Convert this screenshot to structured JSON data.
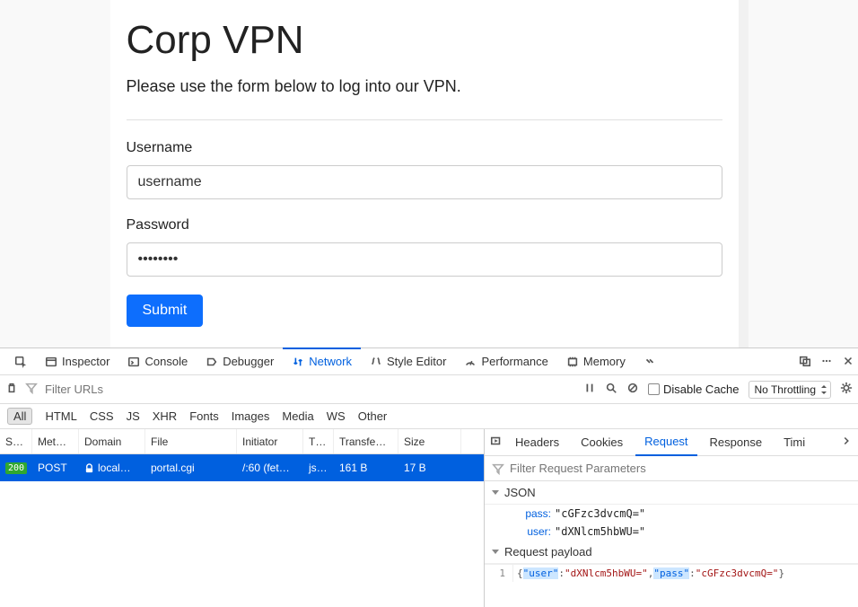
{
  "page": {
    "title": "Corp VPN",
    "subtitle": "Please use the form below to log into our VPN.",
    "username_label": "Username",
    "username_value": "username",
    "password_label": "Password",
    "password_value": "password",
    "submit_label": "Submit"
  },
  "devtools": {
    "tabs": {
      "inspector": "Inspector",
      "console": "Console",
      "debugger": "Debugger",
      "network": "Network",
      "style_editor": "Style Editor",
      "performance": "Performance",
      "memory": "Memory"
    },
    "active_tab": "network",
    "filter_placeholder": "Filter URLs",
    "disable_cache_label": "Disable Cache",
    "throttling_label": "No Throttling",
    "type_filters": [
      "All",
      "HTML",
      "CSS",
      "JS",
      "XHR",
      "Fonts",
      "Images",
      "Media",
      "WS",
      "Other"
    ],
    "type_active": "All",
    "columns": {
      "status": "S…",
      "method": "Met…",
      "domain": "Domain",
      "file": "File",
      "initiator": "Initiator",
      "type": "T…",
      "transferred": "Transfe…",
      "size": "Size"
    },
    "request_row": {
      "status": "200",
      "method": "POST",
      "domain": "local…",
      "file": "portal.cgi",
      "initiator": "/:60 (fet…",
      "type": "js…",
      "transferred": "161 B",
      "size": "17 B"
    },
    "details": {
      "tabs": {
        "headers": "Headers",
        "cookies": "Cookies",
        "request": "Request",
        "response": "Response",
        "timings": "Timi"
      },
      "active": "request",
      "filter_placeholder": "Filter Request Parameters",
      "json_heading": "JSON",
      "json_kv": {
        "pass_key": "pass:",
        "pass_val": "\"cGFzc3dvcmQ=\"",
        "user_key": "user:",
        "user_val": "\"dXNlcm5hbWU=\""
      },
      "payload_heading": "Request payload",
      "payload_line_num": "1",
      "payload_code": "{\"user\":\"dXNlcm5hbWU=\",\"pass\":\"cGFzc3dvcmQ=\"}"
    }
  }
}
